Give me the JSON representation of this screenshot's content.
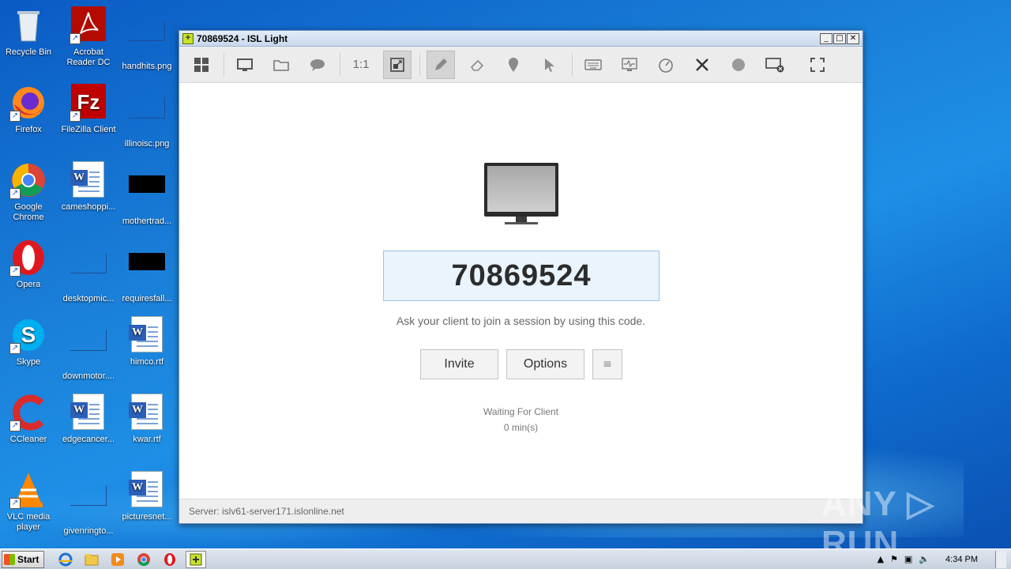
{
  "desktop": {
    "icons": [
      {
        "label": "Recycle Bin"
      },
      {
        "label": "Acrobat Reader DC"
      },
      {
        "label": "handhits.png"
      },
      {
        "label": "Firefox"
      },
      {
        "label": "FileZilla Client"
      },
      {
        "label": "illinoisc.png"
      },
      {
        "label": "Google Chrome"
      },
      {
        "label": "cameshoppi..."
      },
      {
        "label": "mothertrad..."
      },
      {
        "label": "Opera"
      },
      {
        "label": "desktopmic..."
      },
      {
        "label": "requiresfall..."
      },
      {
        "label": "Skype"
      },
      {
        "label": "downmotor...."
      },
      {
        "label": "himco.rtf"
      },
      {
        "label": "CCleaner"
      },
      {
        "label": "edgecancer..."
      },
      {
        "label": "kwar.rtf"
      },
      {
        "label": "VLC media player"
      },
      {
        "label": "givenringto..."
      },
      {
        "label": "picturesnet..."
      }
    ]
  },
  "window": {
    "title": "70869524 - ISL Light",
    "controls": {
      "minimize": "_",
      "maximize": "□",
      "close": "✕"
    },
    "toolbar": {
      "icons": [
        "grid-icon",
        "monitor-icon",
        "folder-icon",
        "chat-icon",
        "one-to-one",
        "fit-icon",
        "pencil-icon",
        "eraser-icon",
        "pin-icon",
        "pointer-icon",
        "keyboard-icon",
        "system-info-icon",
        "speed-icon",
        "tools-icon",
        "record-icon",
        "disconnect-screen-icon",
        "fullscreen-icon"
      ],
      "one_to_one_label": "1:1"
    },
    "session_code": "70869524",
    "hint": "Ask your client to join a session by using this code.",
    "invite_label": "Invite",
    "options_label": "Options",
    "menu_label": "≡",
    "status_line1": "Waiting For Client",
    "status_line2": "0 min(s)",
    "server": "Server: islv61-server171.islonline.net"
  },
  "watermark": "ANY ▷ RUN",
  "taskbar": {
    "start_label": "Start",
    "clock": "4:34 PM"
  }
}
